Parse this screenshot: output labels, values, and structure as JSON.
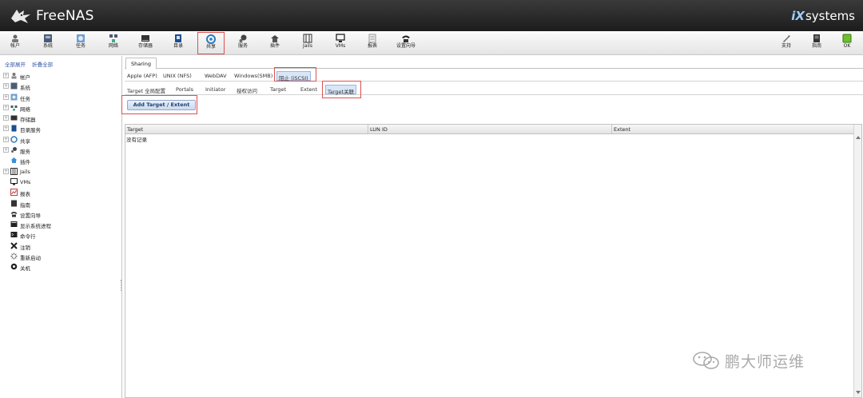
{
  "header": {
    "logo_text": "FreeNAS",
    "vendor_prefix": "iX",
    "vendor_suffix": "systems"
  },
  "toolbar": {
    "items": [
      {
        "label": "帐户",
        "icon": "users-icon"
      },
      {
        "label": "系统",
        "icon": "system-icon"
      },
      {
        "label": "任务",
        "icon": "tasks-icon"
      },
      {
        "label": "网络",
        "icon": "network-icon"
      },
      {
        "label": "存储器",
        "icon": "storage-icon"
      },
      {
        "label": "目录",
        "icon": "directory-icon"
      },
      {
        "label": "共享",
        "icon": "sharing-icon"
      },
      {
        "label": "服务",
        "icon": "services-icon"
      },
      {
        "label": "插件",
        "icon": "plugins-icon"
      },
      {
        "label": "Jails",
        "icon": "jails-icon"
      },
      {
        "label": "VMs",
        "icon": "vms-icon"
      },
      {
        "label": "报表",
        "icon": "reports-icon"
      },
      {
        "label": "设置向导",
        "icon": "wizard-icon"
      },
      {
        "label": "支持",
        "icon": "support-icon"
      },
      {
        "label": "指南",
        "icon": "guide-icon"
      },
      {
        "label": "OK",
        "icon": "alert-ok-icon"
      }
    ],
    "active": "共享"
  },
  "tree": {
    "expand_all": "全部展开",
    "collapse_all": "折叠全部",
    "items": [
      {
        "label": "帐户",
        "expandable": true
      },
      {
        "label": "系统",
        "expandable": true
      },
      {
        "label": "任务",
        "expandable": true
      },
      {
        "label": "网络",
        "expandable": true
      },
      {
        "label": "存储器",
        "expandable": true
      },
      {
        "label": "目录服务",
        "expandable": true
      },
      {
        "label": "共享",
        "expandable": true
      },
      {
        "label": "服务",
        "expandable": true
      },
      {
        "label": "插件",
        "expandable": false
      },
      {
        "label": "Jails",
        "expandable": true
      },
      {
        "label": "VMs",
        "expandable": false
      },
      {
        "label": "报表",
        "expandable": false
      },
      {
        "label": "指南",
        "expandable": false
      },
      {
        "label": "设置向导",
        "expandable": false
      },
      {
        "label": "显示系统进程",
        "expandable": false
      },
      {
        "label": "命令行",
        "expandable": false
      },
      {
        "label": "注销",
        "expandable": false
      },
      {
        "label": "重新启动",
        "expandable": false
      },
      {
        "label": "关机",
        "expandable": false
      }
    ]
  },
  "main": {
    "tab": "Sharing",
    "subtabs": [
      "Apple (AFP)",
      "UNIX (NFS)",
      "WebDAV",
      "Windows(SMB)",
      "阻止 (iSCSI)"
    ],
    "subtab_selected": "阻止 (iSCSI)",
    "subsubtabs": [
      "Target 全局配置",
      "Portals",
      "Initiator",
      "授权访问",
      "Target",
      "Extent",
      "Target关联"
    ],
    "subsubtab_selected": "Target关联",
    "add_button": "Add Target / Extent",
    "grid": {
      "columns": [
        "Target",
        "LUN ID",
        "Extent"
      ],
      "empty_text": "没有记录"
    }
  },
  "watermark": {
    "text": "鹏大师运维"
  }
}
